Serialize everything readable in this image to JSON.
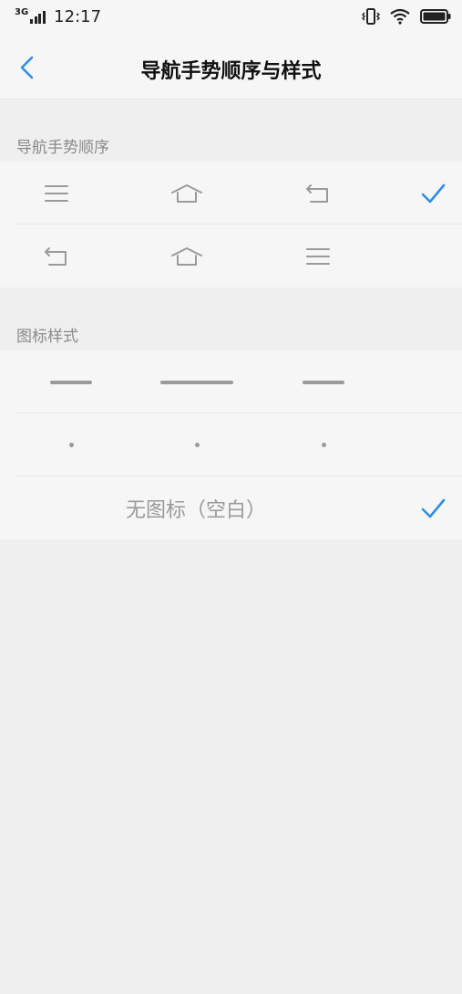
{
  "status": {
    "network": "3G",
    "time": "12:17"
  },
  "header": {
    "title": "导航手势顺序与样式"
  },
  "order_section": {
    "label": "导航手势顺序",
    "options": [
      {
        "icons": [
          "menu-icon",
          "home-icon",
          "back-icon"
        ],
        "selected": true
      },
      {
        "icons": [
          "back-icon",
          "home-icon",
          "menu-icon"
        ],
        "selected": false
      }
    ]
  },
  "style_section": {
    "label": "图标样式",
    "options": [
      {
        "style": "lines",
        "selected": false
      },
      {
        "style": "dots",
        "selected": false
      },
      {
        "style": "blank",
        "label": "无图标（空白）",
        "selected": true
      }
    ]
  },
  "colors": {
    "accent": "#2f8fe3",
    "icon_gray": "#9a9a9a"
  }
}
